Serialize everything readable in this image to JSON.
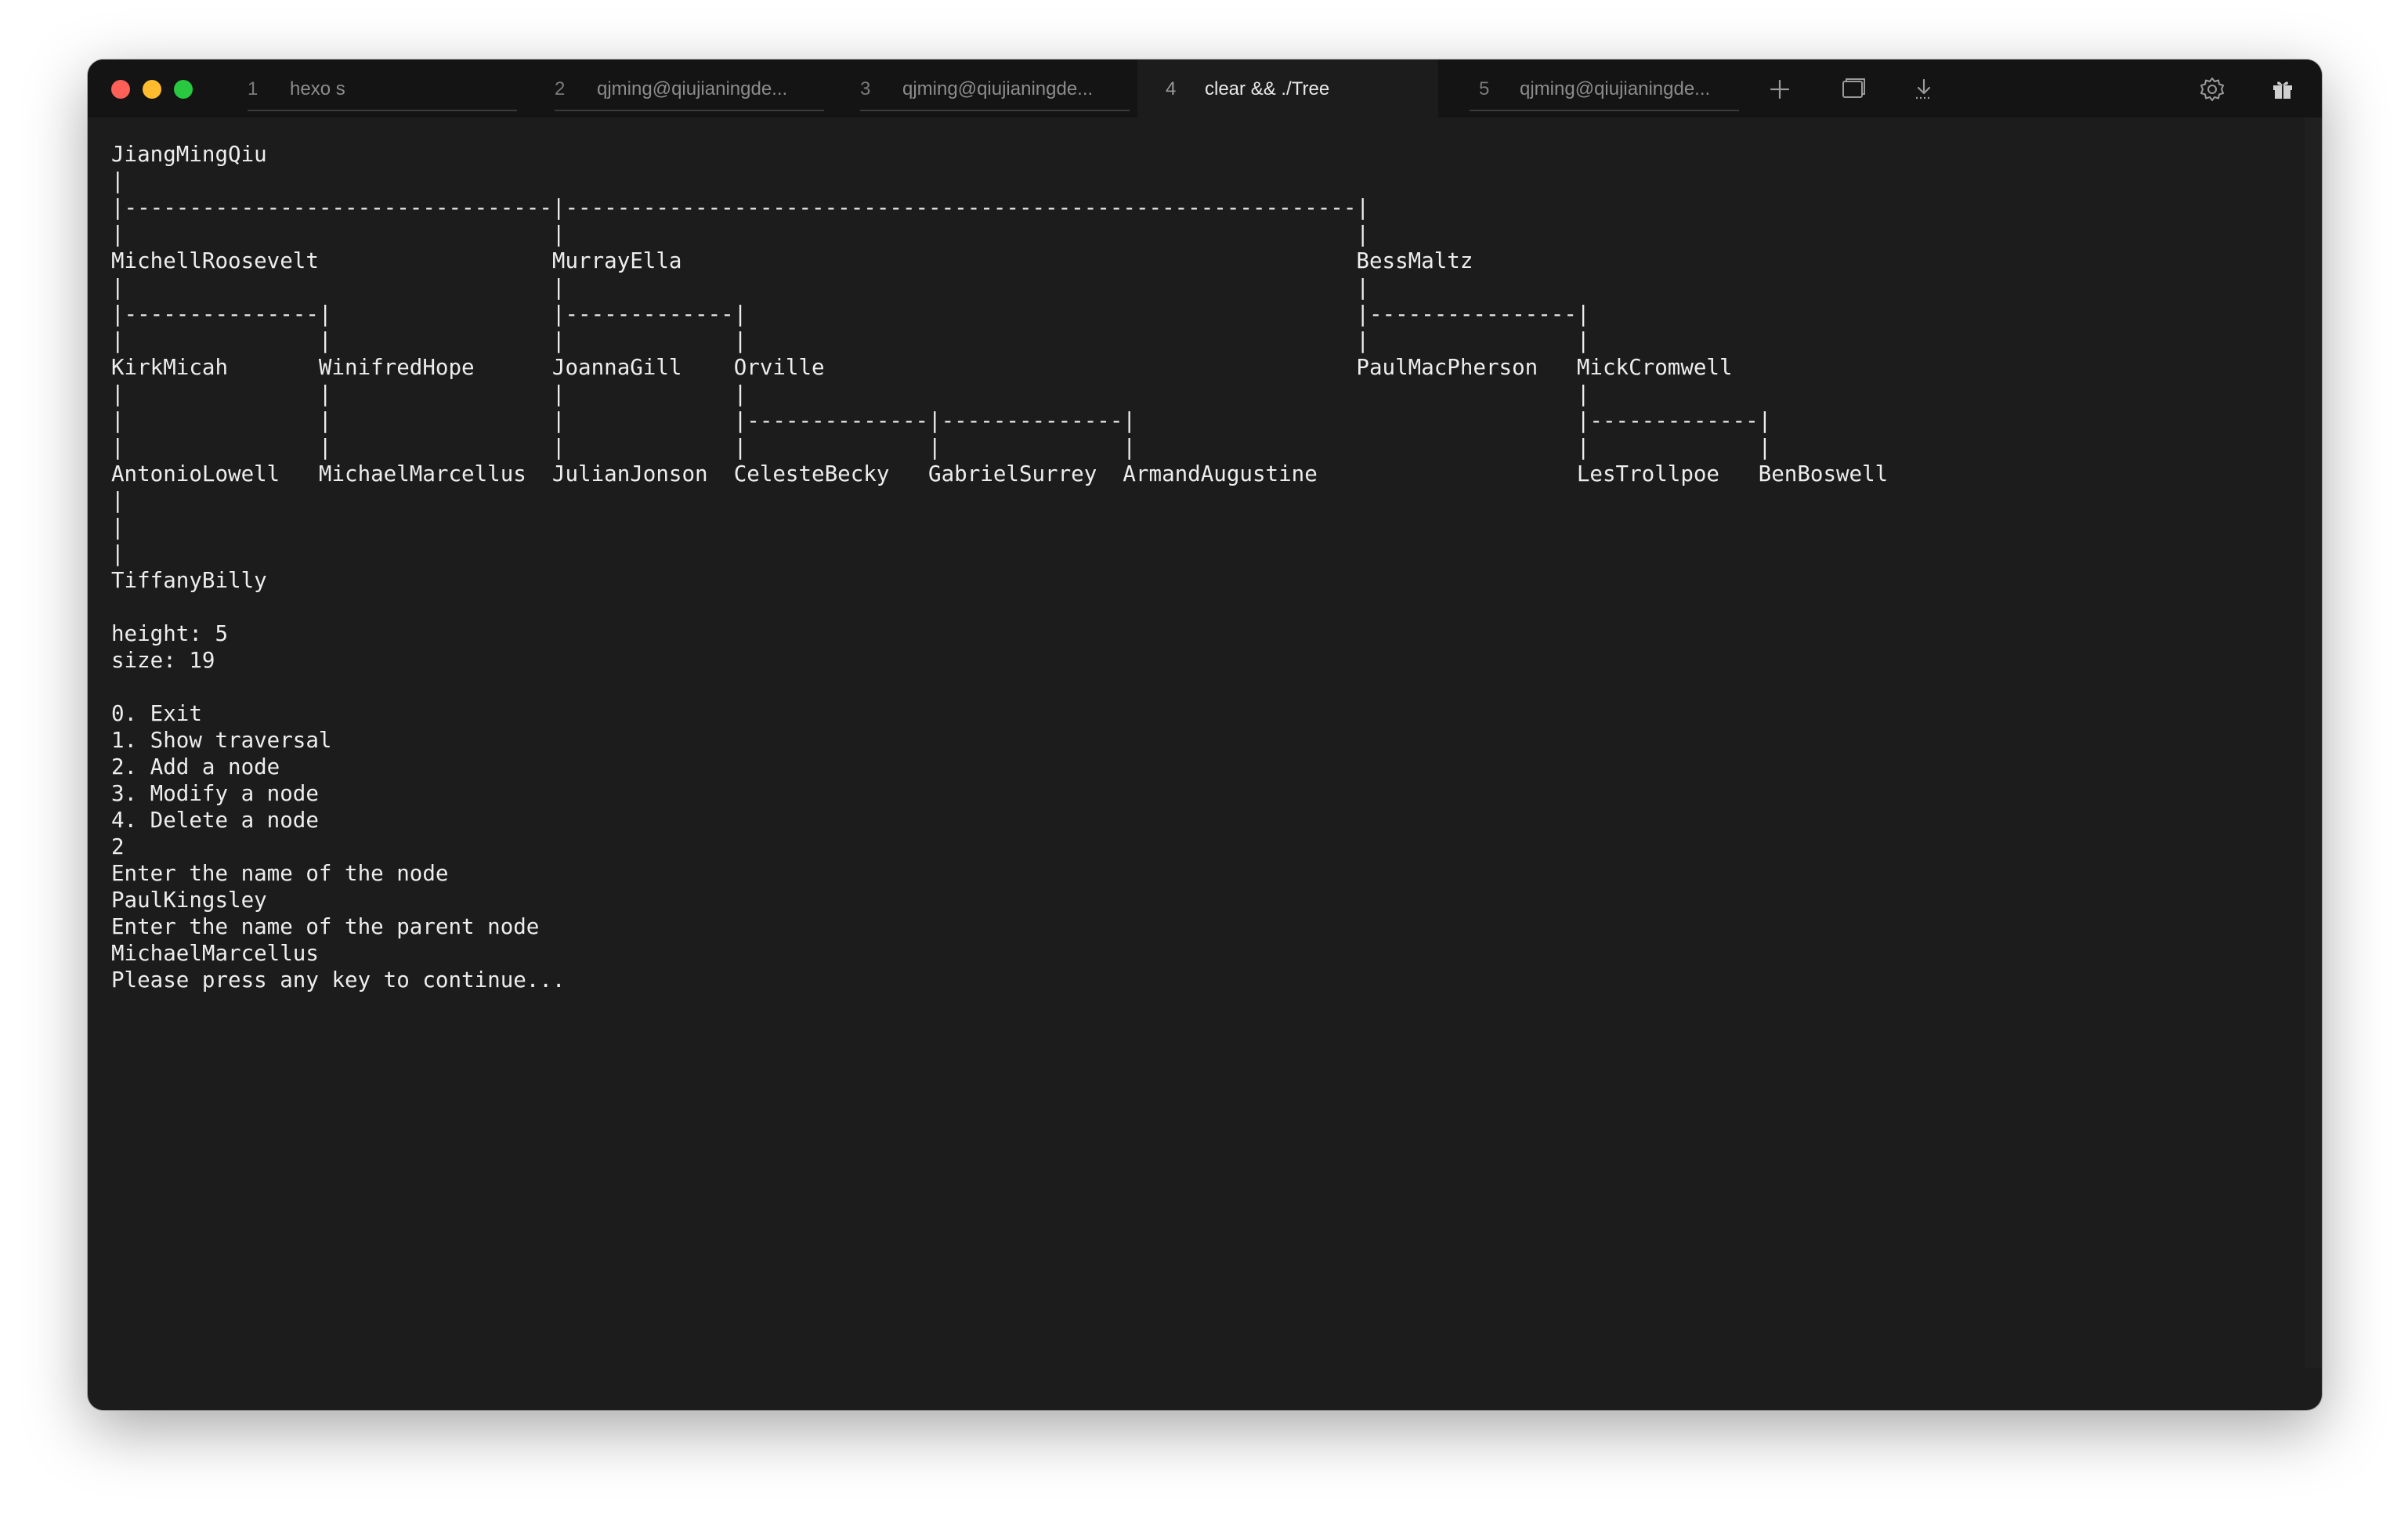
{
  "window": {
    "tabs": [
      {
        "number": "1",
        "title": "hexo s",
        "active": false
      },
      {
        "number": "2",
        "title": "qjming@qiujianingde...",
        "active": false
      },
      {
        "number": "3",
        "title": "qjming@qiujianingde...",
        "active": false
      },
      {
        "number": "4",
        "title": "clear && ./Tree",
        "active": true
      },
      {
        "number": "5",
        "title": "qjming@qiujianingde...",
        "active": false
      }
    ],
    "toolbar_icons": [
      "plus-icon",
      "split-window-icon",
      "download-icon",
      "gear-icon",
      "gift-icon"
    ],
    "colors": {
      "background": "#1c1c1c",
      "titlebar": "#141414",
      "text": "#ededed",
      "close": "#fe5f57",
      "minimize": "#febc2e",
      "maximize": "#28c840"
    }
  },
  "terminal": {
    "tree_lines": [
      "JiangMingQiu",
      "|",
      "|---------------------------------|-------------------------------------------------------------|",
      "|                                 |                                                             |",
      "MichellRoosevelt                  MurrayElla                                                    BessMaltz",
      "|                                 |                                                             |",
      "|---------------|                 |-------------|                                               |----------------|",
      "|               |                 |             |                                               |                |",
      "KirkMicah       WinifredHope      JoannaGill    Orville                                         PaulMacPherson   MickCromwell",
      "|               |                 |             |                                                                |",
      "|               |                 |             |--------------|--------------|                                  |-------------|",
      "|               |                 |             |              |              |                                  |             |",
      "AntonioLowell   MichaelMarcellus  JulianJonson  CelesteBecky   GabrielSurrey  ArmandAugustine                    LesTrollpoe   BenBoswell",
      "|",
      "|",
      "|",
      "TiffanyBilly"
    ],
    "height_line": "height: 5",
    "size_line": "size: 19",
    "menu": [
      "0. Exit",
      "1. Show traversal",
      "2. Add a node",
      "3. Modify a node",
      "4. Delete a node"
    ],
    "session": [
      "2",
      "Enter the name of the node",
      "PaulKingsley",
      "Enter the name of the parent node",
      "MichaelMarcellus",
      "Please press any key to continue..."
    ]
  }
}
